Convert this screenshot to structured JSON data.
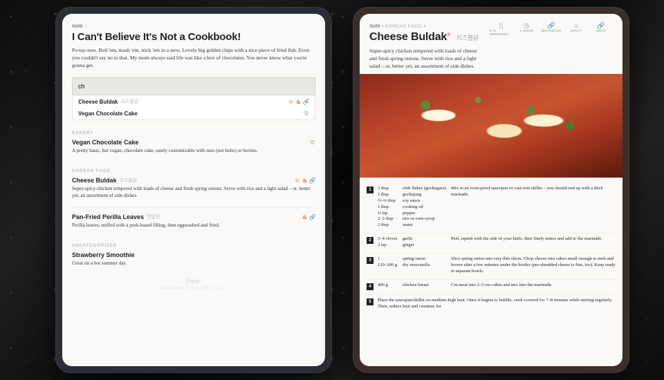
{
  "brand": "nom",
  "left": {
    "title": "I Can't Believe It's Not a Cookbook!",
    "intro": "Po-tay-toes. Boil 'em, mash 'em, stick 'em in a stew. Lovely big golden chips with a nice piece of fried fish. Even you couldn't say no to that. My mom always said life was like a box of chocolates. You never know what you're gonna get.",
    "search_value": "ch",
    "suggestions": [
      {
        "title": "Cheese Buldak",
        "subtitle": "치즈불닭",
        "tags": [
          "star",
          "spicy",
          "meat"
        ]
      },
      {
        "title": "Vegan Chocolate Cake",
        "subtitle": "",
        "tags": [
          "vegan"
        ]
      }
    ],
    "sections": [
      {
        "label": "BAKERY",
        "items": [
          {
            "title": "Vegan Chocolate Cake",
            "subtitle": "",
            "tags": [
              "vegan"
            ],
            "desc": "A pretty basic, but vegan, chocolate cake, easily customizable with nuts (not bolts) or berries."
          }
        ]
      },
      {
        "label": "KOREAN FOOD",
        "items": [
          {
            "title": "Cheese Buldak",
            "subtitle": "치즈불닭",
            "tags": [
              "star",
              "spicy",
              "meat"
            ],
            "desc": "Super-spicy chicken tempered with loads of cheese and fresh spring onions. Serve with rice and a light salad – or, better yet, an assortment of side dishes."
          },
          {
            "title": "Pan-Fried Perilla Leaves",
            "subtitle": "깻잎전",
            "tags": [
              "spicy",
              "meat"
            ],
            "desc": "Perilla leaves, stuffed with a pork-based filling, then eggwashed and fried."
          }
        ]
      },
      {
        "label": "UNCATEGORIZED",
        "items": [
          {
            "title": "Strawberry Smoothie",
            "subtitle": "",
            "tags": [],
            "desc": "Great on a hot summer day."
          }
        ]
      }
    ],
    "footer_enjoy": "Enjoy!",
    "footer_gen": "GENERATED ON 2021-03-15"
  },
  "right": {
    "breadcrumb": "KOREAN FOOD",
    "title": "Cheese Buldak",
    "subtitle": "치즈불닭",
    "intro": "Super-spicy chicken tempered with loads of cheese and fresh spring onions. Serve with rice and a light salad – or, better yet, an assortment of side dishes.",
    "meta": [
      {
        "icon": "🍴",
        "label": "2–3 SERVINGS"
      },
      {
        "icon": "◷",
        "label": "1 HOUR"
      },
      {
        "icon": "🔗",
        "label": "MAANGCHI"
      },
      {
        "icon": "♨",
        "label": "SPICY",
        "cls": "spicy"
      },
      {
        "icon": "🔗",
        "label": "MEAT",
        "cls": "meat"
      }
    ],
    "steps": [
      {
        "n": "1",
        "ingredients": [
          {
            "qty": "2 tbsp",
            "name": "chili flakes (gochugaru)"
          },
          {
            "qty": "1 tbsp",
            "name": "gochujang"
          },
          {
            "qty": "½–⅔ tbsp",
            "name": "soy sauce"
          },
          {
            "qty": "1 tbsp",
            "name": "cooking oil"
          },
          {
            "qty": "¼ tsp",
            "name": "pepper"
          },
          {
            "qty": "2–3 tbsp",
            "name": "rice or corn syrup"
          },
          {
            "qty": "2 tbsp",
            "name": "water"
          }
        ],
        "instr": "Mix in an oven-proof saucepan or cast-iron skillet – you should end up with a thick marinade."
      },
      {
        "n": "2",
        "ingredients": [
          {
            "qty": "3–4 cloves",
            "name": "garlic"
          },
          {
            "qty": "2 tsp",
            "name": "ginger"
          }
        ],
        "instr": "Peel, squish with the side of your knife, then finely mince and add to the marinade."
      },
      {
        "n": "3",
        "ingredients": [
          {
            "qty": "1",
            "name": "spring onion"
          },
          {
            "qty": "120–200 g",
            "name": "dry mozzarella"
          }
        ],
        "instr": "Slice spring onion into very thin slices. Chop cheese into cubes small enough to melt and brown after a few minutes under the broiler (pre-shredded cheese is fine, too). Keep ready in separate bowls."
      },
      {
        "n": "4",
        "ingredients": [
          {
            "qty": "400 g",
            "name": "chicken breast"
          }
        ],
        "instr": "Cut meat into 2–3 cm cubes and mix into the marinade."
      },
      {
        "n": "5",
        "wide": true,
        "ingredients": [],
        "instr": "Place the saucepan/skillet on medium-high heat. Once it begins to bubble, cook covered for 7–8 minutes while stirring regularly. Then, reduce heat and continue for"
      }
    ]
  },
  "icons": {
    "star": "☆",
    "spicy": "♨",
    "meat": "🔗",
    "vegan": "♡"
  }
}
